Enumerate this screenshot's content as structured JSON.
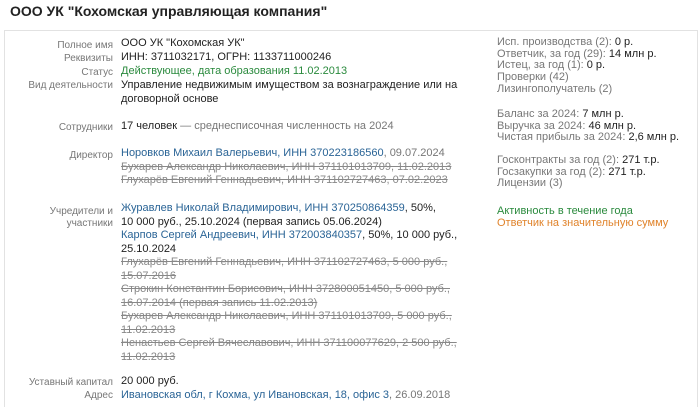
{
  "title": "ООО УК \"Кохомская управляющая компания\"",
  "fields": {
    "full_name": {
      "label": "Полное имя",
      "value": "ООО УК \"Кохомская УК\""
    },
    "requisites": {
      "label": "Реквизиты",
      "value": "ИНН: 3711032171, ОГРН: 1133711000246"
    },
    "status": {
      "label": "Статус",
      "value": "Действующее, дата образования 11.02.2013"
    },
    "activity": {
      "label": "Вид деятельности",
      "line1": "Управление недвижимым имуществом за вознаграждение или на",
      "line2": "договорной основе"
    },
    "employees": {
      "label": "Сотрудники",
      "value": "17 человек",
      "note": " — среднесписочная численность на 2024"
    },
    "director": {
      "label": "Директор",
      "current_name": "Норовков Михаил Валерьевич, ИНН 370223186560",
      "current_date": ", 09.07.2024",
      "former": [
        "Бухарев Александр Николаевич, ИНН 371101013709, 11.02.2013",
        "Глухарёв Евгений Геннадьевич, ИНН 371102727463, 07.02.2023"
      ]
    },
    "founders": {
      "label1": "Учредители и",
      "label2": "участники",
      "current1_link": "Журавлев Николай Владимирович, ИНН 370250864359",
      "current1_rest": ", 50%,",
      "current1_line2": "10 000 руб., 25.10.2024 (первая запись 05.06.2024)",
      "current2_link": "Карпов Сергей Андреевич, ИНН 372003840357",
      "current2_rest": ", 50%, 10 000 руб.,",
      "current2_line2": "25.10.2024",
      "former": [
        "Глухарёв Евгений Геннадьевич, ИНН 371102727463, 5 000 руб.,",
        "15.07.2016",
        "Строкин Константин Борисович, ИНН 372800051450, 5 000 руб.,",
        "16.07.2014 (первая запись 11.02.2013)",
        "Бухарев Александр Николаевич, ИНН 371101013709, 5 000 руб.,",
        "11.02.2013",
        "Ненастьев Сергей Вячеславович, ИНН 371100077629, 2 500 руб.,",
        "11.02.2013"
      ]
    },
    "capital": {
      "label": "Уставный капитал",
      "value": "20 000 руб."
    },
    "address": {
      "label": "Адрес",
      "link": "Ивановская обл, г Кохма, ул Ивановская, 18, офис 3",
      "date": ", 26.09.2018"
    }
  },
  "sidebar": {
    "proceedings": {
      "label": "Исп. производства (2): ",
      "value": "0 р."
    },
    "defendant": {
      "label": "Ответчик, за год (29): ",
      "value": "14 млн р."
    },
    "plaintiff": {
      "label": "Истец, за год (1): ",
      "value": "0 р."
    },
    "inspections": "Проверки (42)",
    "licensees": "Лизингополучатель (2)",
    "balance": {
      "label": "Баланс за 2024: ",
      "value": "7 млн р."
    },
    "revenue": {
      "label": "Выручка за 2024: ",
      "value": "46 млн р."
    },
    "net_profit": {
      "label": "Чистая прибыль за 2024: ",
      "value": "2,6 млн р."
    },
    "contracts": {
      "label": "Госконтракты за год (2): ",
      "value": "271 т.р."
    },
    "purchases": {
      "label": "Госзакупки за год (2): ",
      "value": "271 т.р."
    },
    "licenses": "Лицензии (3)",
    "active": "Активность в течение года",
    "significant_defendant": "Ответчик на значительную сумму"
  }
}
